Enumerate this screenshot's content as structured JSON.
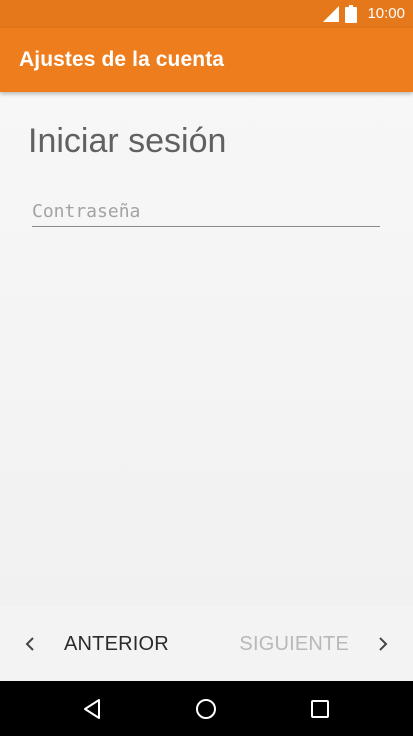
{
  "status_bar": {
    "time": "10:00",
    "icons": [
      "signal-icon",
      "battery-icon"
    ]
  },
  "app_bar": {
    "title": "Ajustes de la cuenta",
    "color": "#ee7d1d"
  },
  "main": {
    "heading": "Iniciar sesión",
    "password_field": {
      "placeholder": "Contraseña",
      "value": ""
    }
  },
  "bottom_nav": {
    "prev_label": "ANTERIOR",
    "next_label": "SIGUIENTE",
    "next_enabled": false
  },
  "system_nav": {
    "buttons": [
      "back-icon",
      "home-icon",
      "recents-icon"
    ]
  }
}
